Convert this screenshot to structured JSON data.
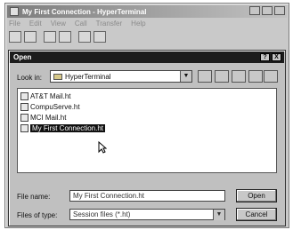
{
  "app": {
    "title": "My First Connection - HyperTerminal"
  },
  "menu": [
    "File",
    "Edit",
    "View",
    "Call",
    "Transfer",
    "Help"
  ],
  "dialog": {
    "title": "Open",
    "help_label": "?",
    "close_label": "X",
    "look_in_label": "Look in:",
    "look_in_value": "HyperTerminal",
    "files": [
      {
        "name": "AT&T Mail.ht",
        "icon": "phone-icon"
      },
      {
        "name": "CompuServe.ht",
        "icon": "terminal-icon"
      },
      {
        "name": "MCI Mail.ht",
        "icon": "terminal-icon"
      },
      {
        "name": "My First Connection.ht",
        "icon": "phone-icon",
        "selected": true
      }
    ],
    "file_name_label": "File name:",
    "file_name_value": "My First Connection.ht",
    "files_of_type_label": "Files of type:",
    "files_of_type_value": "Session files (*.ht)",
    "open_label": "Open",
    "cancel_label": "Cancel"
  }
}
